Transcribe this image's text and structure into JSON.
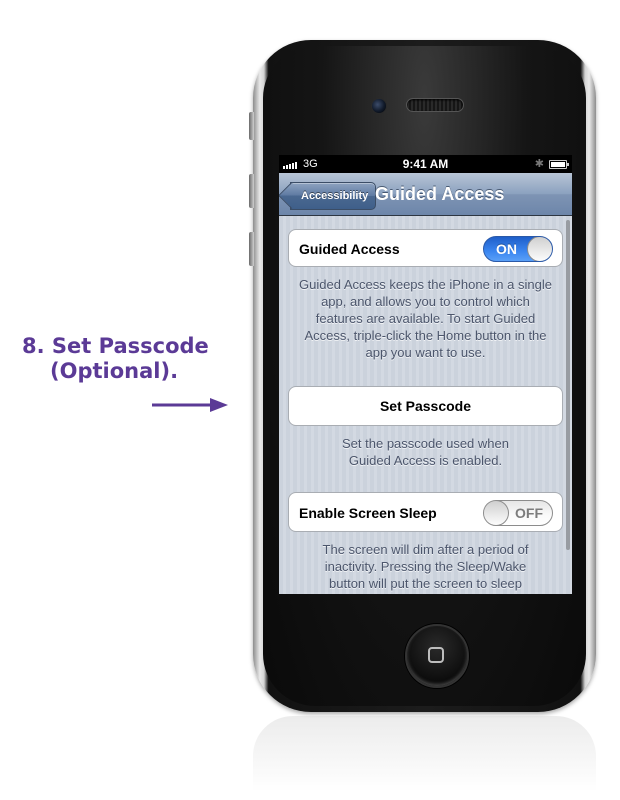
{
  "callout": {
    "line1": "8. Set Passcode",
    "line2": "(Optional).",
    "color": "#5b3a96"
  },
  "status_bar": {
    "carrier": "3G",
    "time": "9:41 AM",
    "bluetooth_icon": "bluetooth-icon",
    "battery_icon": "battery-icon"
  },
  "nav": {
    "back_label": "Accessibility",
    "title": "Guided Access"
  },
  "settings": {
    "guided_access": {
      "label": "Guided Access",
      "toggle": "ON",
      "footer": "Guided Access keeps the iPhone in a single app, and allows you to control which features are available. To start Guided Access, triple-click the Home button in the app you want to use."
    },
    "set_passcode": {
      "label": "Set Passcode",
      "footer": "Set the passcode used when Guided Access is enabled."
    },
    "screen_sleep": {
      "label": "Enable Screen Sleep",
      "toggle": "OFF",
      "footer": "The screen will dim after a period of inactivity. Pressing the Sleep/Wake button will put the screen to sleep"
    }
  },
  "colors": {
    "toggle_on": "#3b86f0",
    "nav_bar": "#7e94b4",
    "footer_text": "#4c566c"
  }
}
